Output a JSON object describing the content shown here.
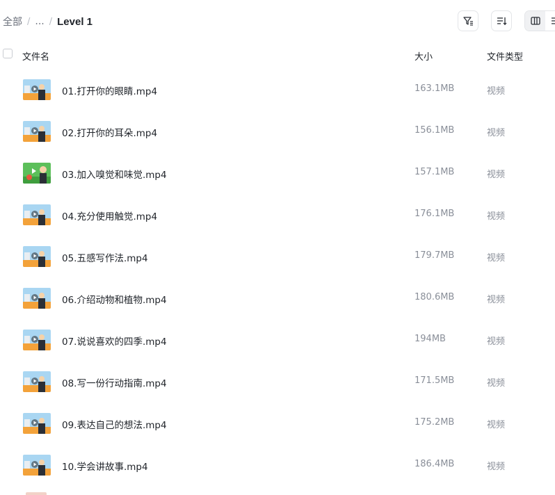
{
  "breadcrumb": {
    "root": "全部",
    "ellipsis": "...",
    "current": "Level 1"
  },
  "toolbar": {
    "filter_icon": "filter-icon",
    "sort_icon": "sort-icon",
    "view_icons": [
      "column-view-icon",
      "list-view-icon"
    ]
  },
  "table": {
    "headers": {
      "name": "文件名",
      "size": "大小",
      "type": "文件类型"
    },
    "rows": [
      {
        "name": "01.打开你的眼睛.mp4",
        "size": "163.1MB",
        "type": "视频",
        "thumb": "video-thumbnail-teacher"
      },
      {
        "name": "02.打开你的耳朵.mp4",
        "size": "156.1MB",
        "type": "视频",
        "thumb": "video-thumbnail-teacher"
      },
      {
        "name": "03.加入嗅觉和味觉.mp4",
        "size": "157.1MB",
        "type": "视频",
        "thumb": "video-thumbnail-green"
      },
      {
        "name": "04.充分使用触觉.mp4",
        "size": "176.1MB",
        "type": "视频",
        "thumb": "video-thumbnail-teacher"
      },
      {
        "name": "05.五感写作法.mp4",
        "size": "179.7MB",
        "type": "视频",
        "thumb": "video-thumbnail-teacher"
      },
      {
        "name": "06.介绍动物和植物.mp4",
        "size": "180.6MB",
        "type": "视频",
        "thumb": "video-thumbnail-teacher"
      },
      {
        "name": "07.说说喜欢的四季.mp4",
        "size": "194MB",
        "type": "视频",
        "thumb": "video-thumbnail-teacher"
      },
      {
        "name": "08.写一份行动指南.mp4",
        "size": "171.5MB",
        "type": "视频",
        "thumb": "video-thumbnail-teacher"
      },
      {
        "name": "09.表达自己的想法.mp4",
        "size": "175.2MB",
        "type": "视频",
        "thumb": "video-thumbnail-teacher"
      },
      {
        "name": "10.学会讲故事.mp4",
        "size": "186.4MB",
        "type": "视频",
        "thumb": "video-thumbnail-teacher"
      }
    ]
  },
  "colors": {
    "text_primary": "#1f2329",
    "text_secondary": "#8a8f99",
    "border": "#e3e5e8",
    "thumb_sky": "#a9d6f2",
    "thumb_floor": "#f3a23a",
    "thumb_green": "#5cbf5a"
  }
}
